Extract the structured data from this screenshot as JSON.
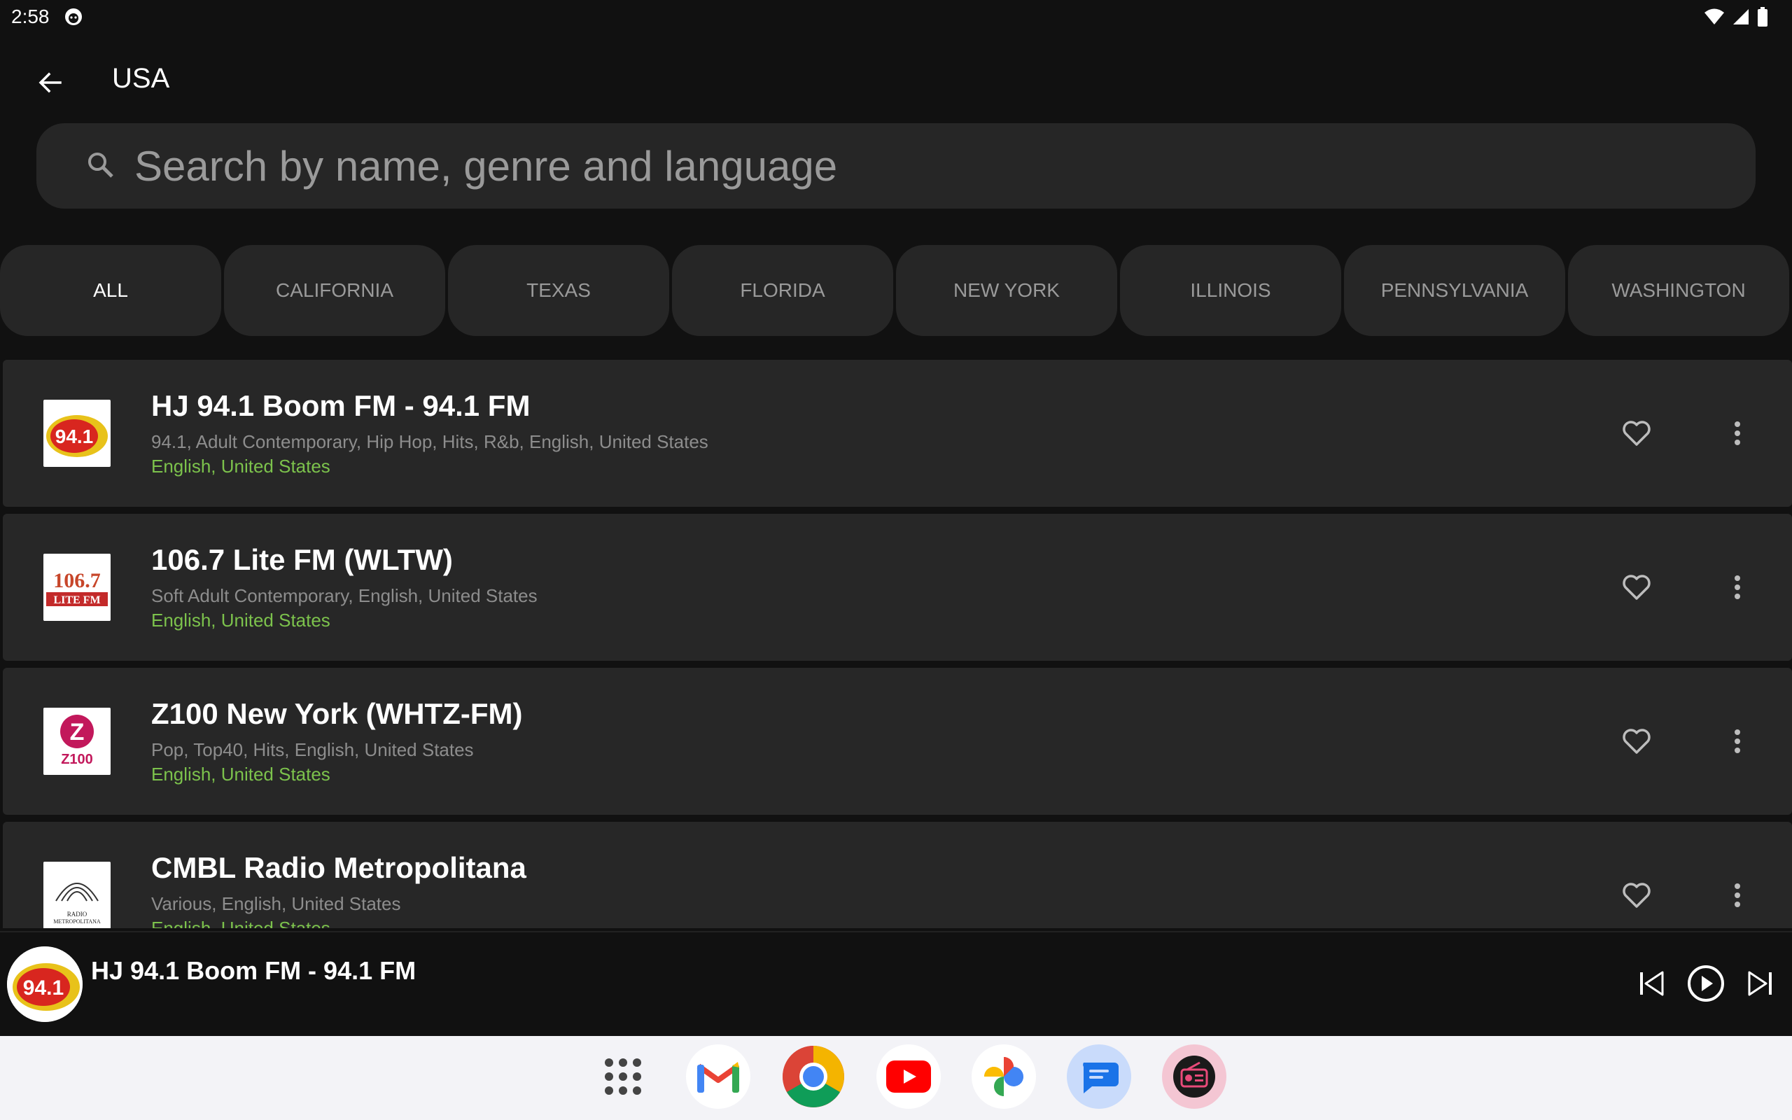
{
  "status": {
    "time": "2:58",
    "icons": [
      "notification-icon",
      "wifi-icon",
      "signal-icon",
      "battery-icon"
    ]
  },
  "header": {
    "title": "USA",
    "back_icon": "arrow-left-icon"
  },
  "search": {
    "placeholder": "Search by name, genre and language",
    "value": ""
  },
  "chips": [
    {
      "label": "ALL",
      "active": true
    },
    {
      "label": "CALIFORNIA",
      "active": false
    },
    {
      "label": "TEXAS",
      "active": false
    },
    {
      "label": "FLORIDA",
      "active": false
    },
    {
      "label": "NEW YORK",
      "active": false
    },
    {
      "label": "ILLINOIS",
      "active": false
    },
    {
      "label": "PENNSYLVANIA",
      "active": false
    },
    {
      "label": "WASHINGTON",
      "active": false
    }
  ],
  "stations": [
    {
      "title": "HJ 94.1 Boom FM - 94.1 FM",
      "subtitle": "94.1, Adult Contemporary, Hip Hop, Hits, R&b, English,  United States",
      "lang": "English,  United States",
      "logo": "boom-fm-logo",
      "logo_text": "94.1"
    },
    {
      "title": "106.7 Lite FM (WLTW)",
      "subtitle": "Soft Adult Contemporary, English,  United States",
      "lang": "English,  United States",
      "logo": "lite-fm-logo",
      "logo_text": "106.7"
    },
    {
      "title": "Z100 New York (WHTZ-FM)",
      "subtitle": "Pop, Top40, Hits, English,  United States",
      "lang": "English,  United States",
      "logo": "z100-logo",
      "logo_text": "Z100"
    },
    {
      "title": "CMBL Radio Metropolitana",
      "subtitle": "Various, English,  United States",
      "lang": "English,  United States",
      "logo": "radio-metropolitana-logo",
      "logo_text": "RADIO METROPOLITANA"
    }
  ],
  "now_playing": {
    "title": "HJ 94.1 Boom FM - 94.1 FM",
    "logo_text": "94.1"
  },
  "dock": {
    "apps": [
      "app-drawer-icon",
      "gmail-icon",
      "chrome-icon",
      "youtube-icon",
      "photos-icon",
      "messages-icon",
      "radio-app-icon"
    ]
  },
  "colors": {
    "background": "#111111",
    "surface": "#272727",
    "accent_green": "#7cc24c",
    "muted_text": "#8d8d8d"
  }
}
